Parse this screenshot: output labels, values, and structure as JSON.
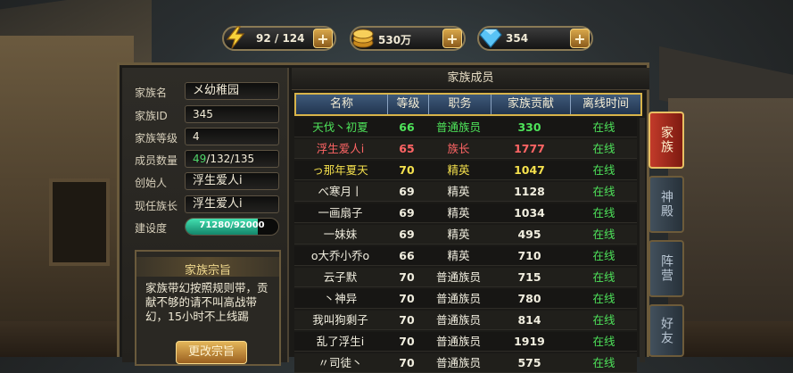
{
  "resources": {
    "energy": {
      "value": "92 / 124",
      "icon": "lightning-icon"
    },
    "gold": {
      "value": "530万",
      "icon": "gold-coins-icon"
    },
    "diamond": {
      "value": "354",
      "icon": "diamond-icon"
    },
    "plus": "+"
  },
  "clan_info": {
    "name_label": "家族名",
    "name": "メ幼稚园",
    "id_label": "家族ID",
    "id": "345",
    "level_label": "家族等级",
    "level": "4",
    "members_label": "成员数量",
    "members_current": "49",
    "members_rest": "/132/135",
    "founder_label": "创始人",
    "founder": "浮生爱人i",
    "leader_label": "现任族长",
    "leader": "浮生爱人i",
    "build_label": "建设度",
    "build_text": "71280/92000",
    "build_progress": 0.775
  },
  "motto": {
    "title": "家族宗旨",
    "text": "家族带幻按照规则带，贡献不够的请不叫高战带幻，15小时不上线踢",
    "button": "更改宗旨"
  },
  "members_panel": {
    "title": "家族成员",
    "columns": [
      "名称",
      "等级",
      "职务",
      "家族贡献",
      "离线时间"
    ],
    "rows": [
      {
        "name": "天伐丶初夏",
        "level": "66",
        "role": "普通族员",
        "contribution": "330",
        "status": "在线",
        "color": "green"
      },
      {
        "name": "浮生爱人i",
        "level": "65",
        "role": "族长",
        "contribution": "1777",
        "status": "在线",
        "color": "red"
      },
      {
        "name": "っ那年夏天",
        "level": "70",
        "role": "精英",
        "contribution": "1047",
        "status": "在线",
        "color": "yellow"
      },
      {
        "name": "べ寒月丨",
        "level": "69",
        "role": "精英",
        "contribution": "1128",
        "status": "在线",
        "color": "white"
      },
      {
        "name": "一画扇子",
        "level": "69",
        "role": "精英",
        "contribution": "1034",
        "status": "在线",
        "color": "white"
      },
      {
        "name": "一妹妹",
        "level": "69",
        "role": "精英",
        "contribution": "495",
        "status": "在线",
        "color": "white"
      },
      {
        "name": "o大乔小乔o",
        "level": "66",
        "role": "精英",
        "contribution": "710",
        "status": "在线",
        "color": "white"
      },
      {
        "name": "云子默",
        "level": "70",
        "role": "普通族员",
        "contribution": "715",
        "status": "在线",
        "color": "white"
      },
      {
        "name": "丶神异",
        "level": "70",
        "role": "普通族员",
        "contribution": "780",
        "status": "在线",
        "color": "white"
      },
      {
        "name": "我叫狗剩子",
        "level": "70",
        "role": "普通族员",
        "contribution": "814",
        "status": "在线",
        "color": "white"
      },
      {
        "name": "乱了浮生i",
        "level": "70",
        "role": "普通族员",
        "contribution": "1919",
        "status": "在线",
        "color": "white"
      },
      {
        "name": "〃司徒丶",
        "level": "70",
        "role": "普通族员",
        "contribution": "575",
        "status": "在线",
        "color": "white"
      }
    ]
  },
  "side_tabs": [
    {
      "label": "家族",
      "active": true
    },
    {
      "label": "神殿",
      "active": false
    },
    {
      "label": "阵营",
      "active": false
    },
    {
      "label": "好友",
      "active": false
    }
  ]
}
